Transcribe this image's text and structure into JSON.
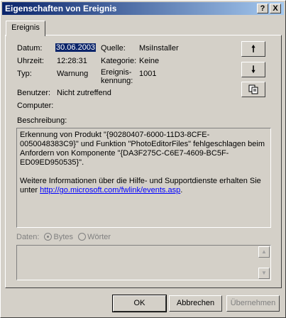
{
  "window": {
    "title": "Eigenschaften von Ereignis",
    "help_glyph": "?",
    "close_glyph": "X"
  },
  "tab": {
    "label": "Ereignis"
  },
  "fields": {
    "datum_label": "Datum:",
    "datum_value": "30.06.2003",
    "uhrzeit_label": "Uhrzeit:",
    "uhrzeit_value": "12:28:31",
    "typ_label": "Typ:",
    "typ_value": "Warnung",
    "quelle_label": "Quelle:",
    "quelle_value": "MsiInstaller",
    "kategorie_label": "Kategorie:",
    "kategorie_value": "Keine",
    "kennung_label_1": "Ereignis-",
    "kennung_label_2": "kennung:",
    "kennung_value": "1001",
    "benutzer_label": "Benutzer:",
    "benutzer_value": "Nicht zutreffend",
    "computer_label": "Computer:",
    "computer_value": ""
  },
  "side_buttons": {
    "up": "up-arrow-icon",
    "down": "down-arrow-icon",
    "copy": "copy-icon"
  },
  "description": {
    "label": "Beschreibung:",
    "para1": "Erkennung von Produkt \"{90280407-6000-11D3-8CFE-0050048383C9}\" und Funktion \"PhotoEditorFiles\" fehlgeschlagen beim Anfordern von Komponente \"{DA3F275C-C6E7-4609-BC5F-ED09ED950535}\".",
    "para2_prefix": "Weitere Informationen über die Hilfe- und Supportdienste erhalten Sie unter ",
    "link": "http://go.microsoft.com/fwlink/events.asp",
    "para2_suffix": "."
  },
  "data_section": {
    "label": "Daten:",
    "bytes": "Bytes",
    "woerter": "Wörter"
  },
  "buttons": {
    "ok": "OK",
    "cancel": "Abbrechen",
    "apply": "Übernehmen"
  }
}
